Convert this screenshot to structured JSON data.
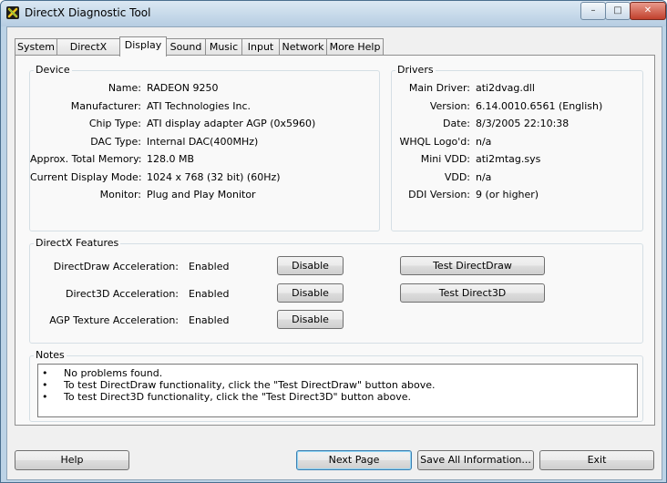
{
  "window": {
    "title": "DirectX Diagnostic Tool",
    "controls": {
      "minimize": "–",
      "maximize": "□",
      "close": "✕"
    }
  },
  "tabs": [
    {
      "label": "System"
    },
    {
      "label": "DirectX Files"
    },
    {
      "label": "Display",
      "active": true
    },
    {
      "label": "Sound"
    },
    {
      "label": "Music"
    },
    {
      "label": "Input"
    },
    {
      "label": "Network"
    },
    {
      "label": "More Help"
    }
  ],
  "device": {
    "title": "Device",
    "fields": [
      {
        "label": "Name:",
        "value": "RADEON 9250"
      },
      {
        "label": "Manufacturer:",
        "value": "ATI Technologies Inc."
      },
      {
        "label": "Chip Type:",
        "value": "ATI display adapter AGP (0x5960)"
      },
      {
        "label": "DAC Type:",
        "value": "Internal DAC(400MHz)"
      },
      {
        "label": "Approx. Total Memory:",
        "value": "128.0 MB"
      },
      {
        "label": "Current Display Mode:",
        "value": "1024 x 768 (32 bit) (60Hz)"
      },
      {
        "label": "Monitor:",
        "value": "Plug and Play Monitor"
      }
    ]
  },
  "drivers": {
    "title": "Drivers",
    "fields": [
      {
        "label": "Main Driver:",
        "value": "ati2dvag.dll"
      },
      {
        "label": "Version:",
        "value": "6.14.0010.6561 (English)"
      },
      {
        "label": "Date:",
        "value": "8/3/2005 22:10:38"
      },
      {
        "label": "WHQL Logo'd:",
        "value": "n/a"
      },
      {
        "label": "Mini VDD:",
        "value": "ati2mtag.sys"
      },
      {
        "label": "VDD:",
        "value": "n/a"
      },
      {
        "label": "DDI Version:",
        "value": "9 (or higher)"
      }
    ]
  },
  "features": {
    "title": "DirectX Features",
    "rows": [
      {
        "label": "DirectDraw Acceleration:",
        "status": "Enabled",
        "button": "Disable",
        "test_button": "Test DirectDraw"
      },
      {
        "label": "Direct3D Acceleration:",
        "status": "Enabled",
        "button": "Disable",
        "test_button": "Test Direct3D"
      },
      {
        "label": "AGP Texture Acceleration:",
        "status": "Enabled",
        "button": "Disable"
      }
    ]
  },
  "notes": {
    "title": "Notes",
    "bullet": "•",
    "items": [
      "No problems found.",
      "To test DirectDraw functionality, click the \"Test DirectDraw\" button above.",
      "To test Direct3D functionality, click the \"Test Direct3D\" button above."
    ]
  },
  "footer": {
    "help": "Help",
    "next_page": "Next Page",
    "save_all": "Save All Information...",
    "exit": "Exit"
  }
}
